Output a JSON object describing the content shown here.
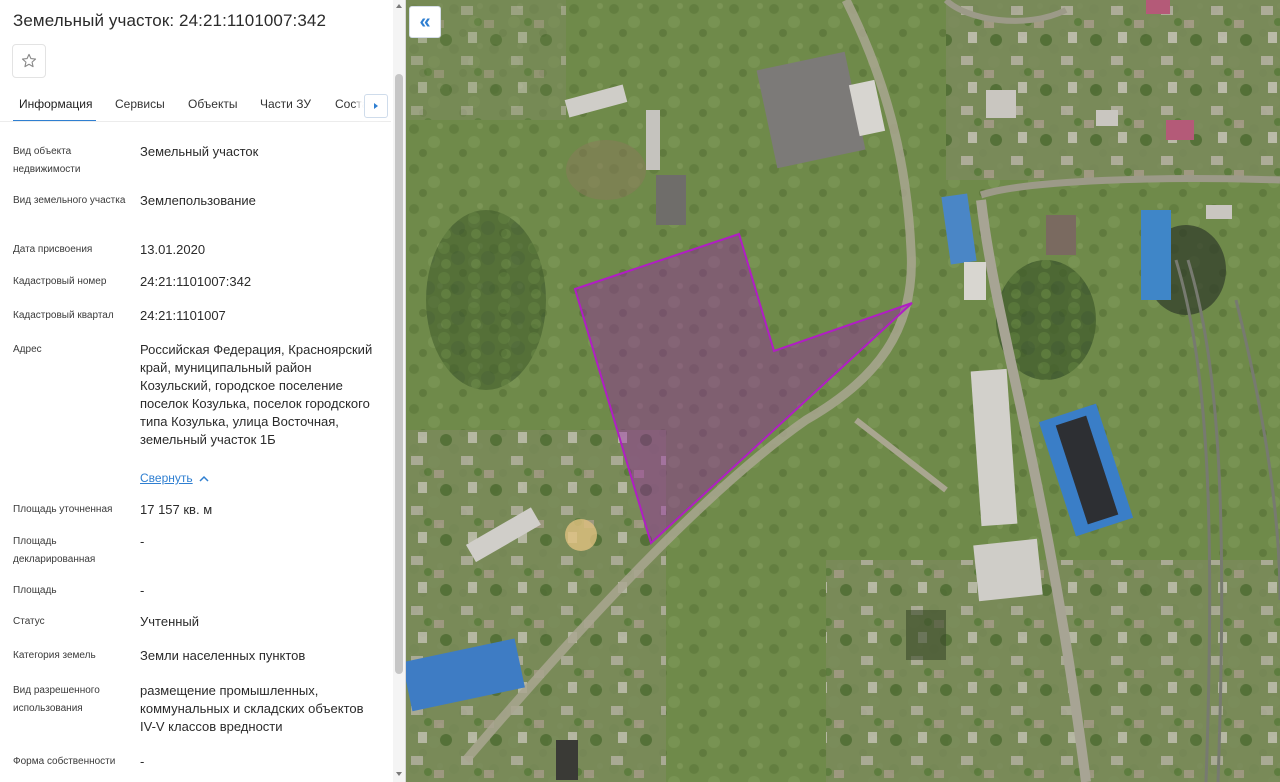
{
  "panel": {
    "title": "Земельный участок: 24:21:1101007:342",
    "favorite_icon": "star-icon",
    "tabs": [
      {
        "label": "Информация"
      },
      {
        "label": "Сервисы"
      },
      {
        "label": "Объекты"
      },
      {
        "label": "Части ЗУ"
      },
      {
        "label": "Соста"
      }
    ],
    "rows": [
      {
        "label": "Вид объекта недвижимости",
        "value": "Земельный участок"
      },
      {
        "label": "Вид земельного участка",
        "value": "Землепользование"
      },
      {
        "label": "Дата присвоения",
        "value": "13.01.2020"
      },
      {
        "label": "Кадастровый номер",
        "value": "24:21:1101007:342"
      },
      {
        "label": "Кадастровый квартал",
        "value": "24:21:1101007"
      },
      {
        "label": "Адрес",
        "value": "Российская Федерация, Красноярский край, муниципальный район Козульский, городское поселение поселок Козулька, поселок городского типа Козулька, улица Восточная, земельный участок 1Б"
      },
      {
        "label": "Площадь уточненная",
        "value": "17 157 кв. м"
      },
      {
        "label": "Площадь декларированная",
        "value": "-"
      },
      {
        "label": "Площадь",
        "value": "-"
      },
      {
        "label": "Статус",
        "value": "Учтенный"
      },
      {
        "label": "Категория земель",
        "value": "Земли населенных пунктов"
      },
      {
        "label": "Вид разрешенного использования",
        "value": "размещение промышленных, коммунальных и складских объектов IV-V классов вредности"
      },
      {
        "label": "Форма собственности",
        "value": "-"
      }
    ],
    "collapse_label": "Свернуть"
  },
  "map": {
    "collapse_icon": "double-chevron-left-icon",
    "collapse_glyph": "«",
    "parcel_color": "#9b1bb0"
  }
}
